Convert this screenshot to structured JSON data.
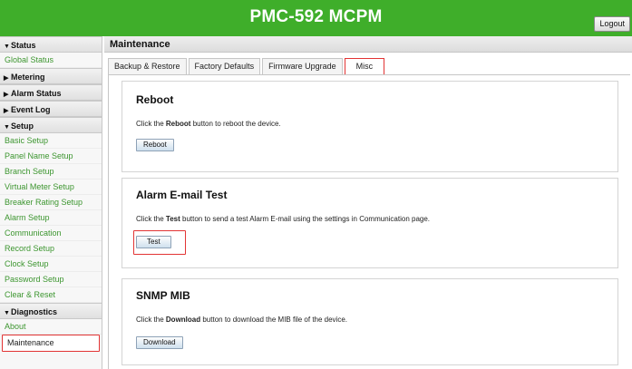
{
  "header": {
    "title": "PMC-592 MCPM",
    "logout_label": "Logout"
  },
  "sidebar": {
    "sections": [
      {
        "label": "Status",
        "expanded": true,
        "items": [
          "Global Status"
        ]
      },
      {
        "label": "Metering",
        "expanded": false,
        "items": []
      },
      {
        "label": "Alarm Status",
        "expanded": false,
        "items": []
      },
      {
        "label": "Event Log",
        "expanded": false,
        "items": []
      },
      {
        "label": "Setup",
        "expanded": true,
        "items": [
          "Basic Setup",
          "Panel Name Setup",
          "Branch Setup",
          "Virtual Meter Setup",
          "Breaker Rating Setup",
          "Alarm Setup",
          "Communication",
          "Record Setup",
          "Clock Setup",
          "Password Setup",
          "Clear & Reset"
        ]
      },
      {
        "label": "Diagnostics",
        "expanded": true,
        "items": [
          "About",
          "Maintenance"
        ]
      }
    ],
    "active_item": "Maintenance"
  },
  "main": {
    "title": "Maintenance",
    "tabs": [
      "Backup & Restore",
      "Factory Defaults",
      "Firmware Upgrade",
      "Misc"
    ],
    "active_tab": "Misc",
    "panels": {
      "reboot": {
        "title": "Reboot",
        "desc_pre": "Click the ",
        "desc_bold": "Reboot",
        "desc_post": " button to reboot the device.",
        "button": "Reboot"
      },
      "alarm": {
        "title": "Alarm E-mail Test",
        "desc_pre": "Click the ",
        "desc_bold": "Test",
        "desc_post": " button to send a test Alarm E-mail using the settings in Communication page.",
        "button": "Test"
      },
      "snmp": {
        "title": "SNMP MIB",
        "desc_pre": "Click the ",
        "desc_bold": "Download",
        "desc_post": " button to download the MIB file of the device.",
        "button": "Download"
      }
    }
  },
  "colors": {
    "header_bg": "#3fae2a",
    "nav_link": "#3d9630",
    "highlight": "#e23434"
  }
}
